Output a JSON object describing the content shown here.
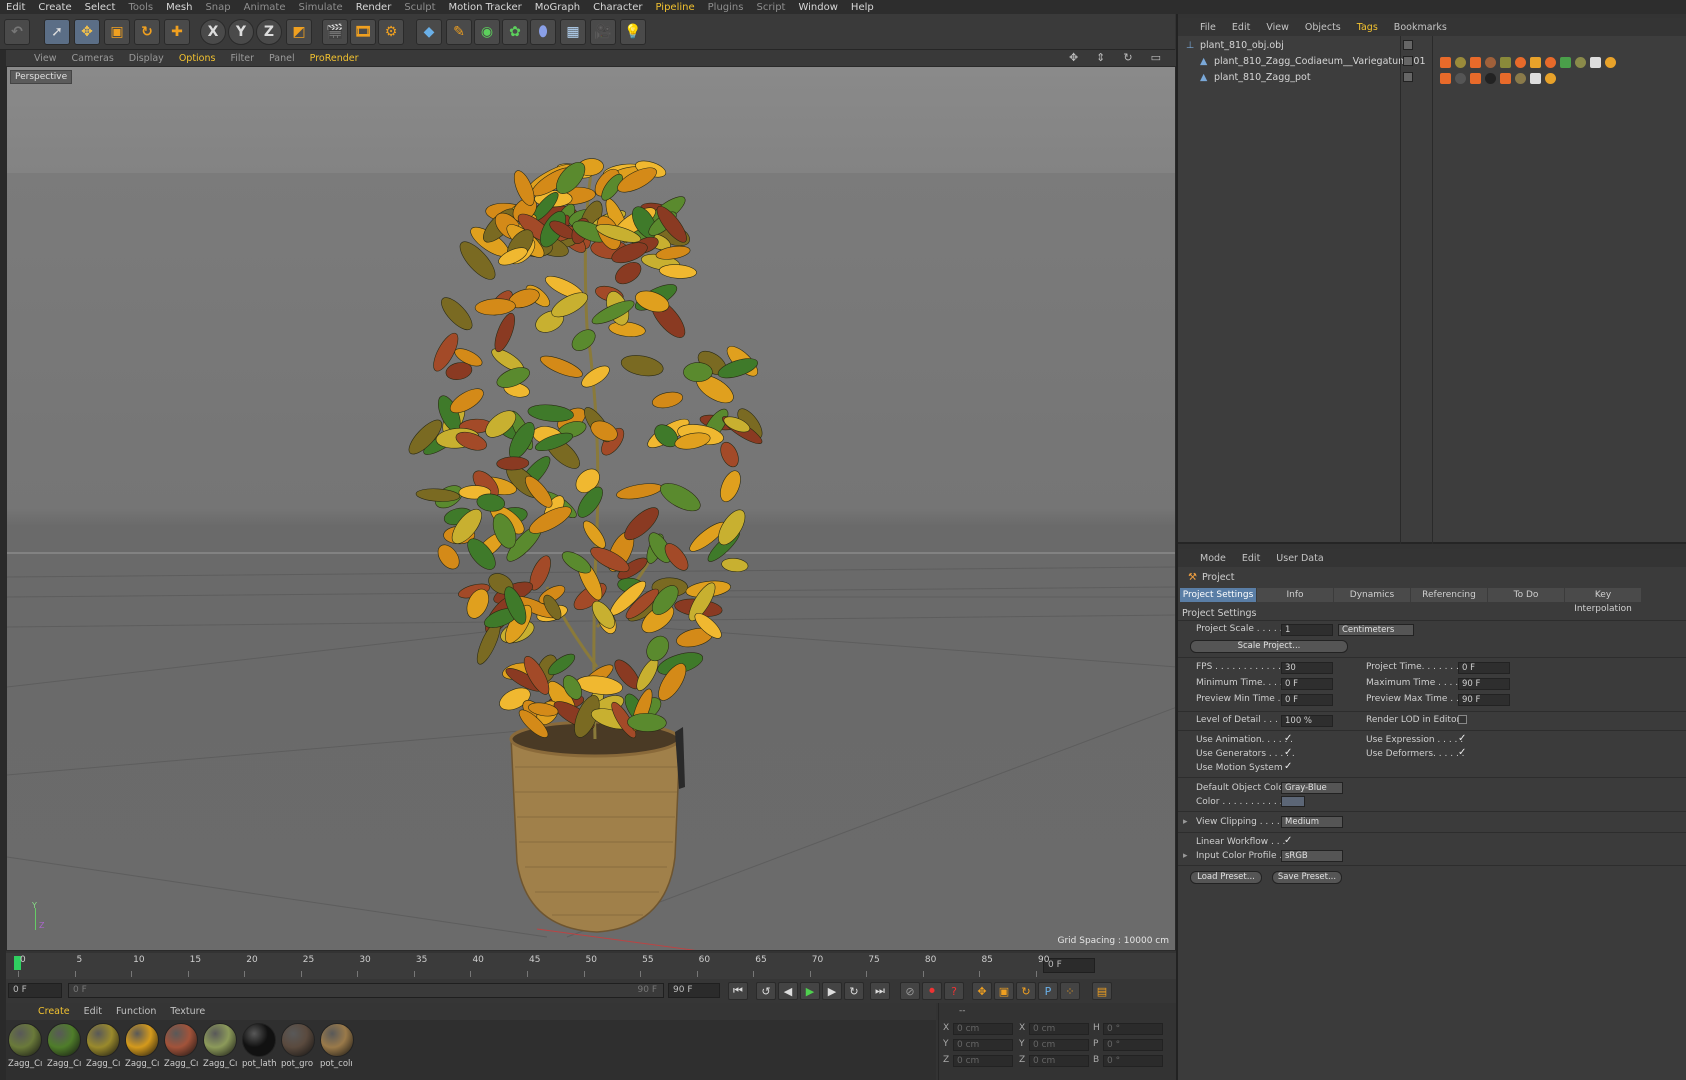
{
  "menubar": {
    "items": [
      {
        "label": "Edit",
        "style": "normal"
      },
      {
        "label": "Create",
        "style": "normal"
      },
      {
        "label": "Select",
        "style": "normal"
      },
      {
        "label": "Tools",
        "style": "dim"
      },
      {
        "label": "Mesh",
        "style": "normal"
      },
      {
        "label": "Snap",
        "style": "dim"
      },
      {
        "label": "Animate",
        "style": "dim"
      },
      {
        "label": "Simulate",
        "style": "dim"
      },
      {
        "label": "Render",
        "style": "normal"
      },
      {
        "label": "Sculpt",
        "style": "dim"
      },
      {
        "label": "Motion Tracker",
        "style": "normal"
      },
      {
        "label": "MoGraph",
        "style": "normal"
      },
      {
        "label": "Character",
        "style": "normal"
      },
      {
        "label": "Pipeline",
        "style": "hl"
      },
      {
        "label": "Plugins",
        "style": "dim"
      },
      {
        "label": "Script",
        "style": "dim"
      },
      {
        "label": "Window",
        "style": "normal"
      },
      {
        "label": "Help",
        "style": "normal"
      }
    ]
  },
  "toolbar": {
    "axis_x": "X",
    "axis_y": "Y",
    "axis_z": "Z"
  },
  "viewport": {
    "menu": [
      {
        "label": "View",
        "hl": false
      },
      {
        "label": "Cameras",
        "hl": false
      },
      {
        "label": "Display",
        "hl": false
      },
      {
        "label": "Options",
        "hl": true
      },
      {
        "label": "Filter",
        "hl": false
      },
      {
        "label": "Panel",
        "hl": false
      },
      {
        "label": "ProRender",
        "hl": true
      }
    ],
    "label": "Perspective",
    "grid_spacing": "Grid Spacing : 10000 cm",
    "axis_y": "Y",
    "axis_z": "Z"
  },
  "timeline": {
    "ticks": [
      "0",
      "5",
      "10",
      "15",
      "20",
      "25",
      "30",
      "35",
      "40",
      "45",
      "50",
      "55",
      "60",
      "65",
      "70",
      "75",
      "80",
      "85",
      "90"
    ],
    "end_field": "0 F",
    "current_frame": "0 F",
    "range_start": "0 F",
    "range_end": "90 F",
    "max_field": "90 F"
  },
  "material_manager": {
    "menu": [
      {
        "label": "Create",
        "hl": true
      },
      {
        "label": "Edit",
        "hl": false
      },
      {
        "label": "Function",
        "hl": false
      },
      {
        "label": "Texture",
        "hl": false
      }
    ],
    "materials": [
      {
        "label": "Zagg_Cı",
        "color": "#6a7a3a"
      },
      {
        "label": "Zagg_Cı",
        "color": "#4f7d2a"
      },
      {
        "label": "Zagg_Cı",
        "color": "#9a8a2c"
      },
      {
        "label": "Zagg_Cı",
        "color": "#d49a1c"
      },
      {
        "label": "Zagg_Cı",
        "color": "#a2533a"
      },
      {
        "label": "Zagg_Cı",
        "color": "#8c9a5a"
      },
      {
        "label": "pot_lath",
        "color": "#111111"
      },
      {
        "label": "pot_gro",
        "color": "#5a4a3e"
      },
      {
        "label": "pot_colı",
        "color": "#9a7a4a"
      }
    ]
  },
  "coordinates": {
    "rows": [
      {
        "a": "X",
        "v1": "0 cm",
        "b": "X",
        "v2": "0 cm",
        "c": "H",
        "v3": "0 °"
      },
      {
        "a": "Y",
        "v1": "0 cm",
        "b": "Y",
        "v2": "0 cm",
        "c": "P",
        "v3": "0 °"
      },
      {
        "a": "Z",
        "v1": "0 cm",
        "b": "Z",
        "v2": "0 cm",
        "c": "B",
        "v3": "0 °"
      }
    ],
    "header": "--"
  },
  "object_manager": {
    "menu": [
      {
        "label": "File",
        "hl": false
      },
      {
        "label": "Edit",
        "hl": false
      },
      {
        "label": "View",
        "hl": false
      },
      {
        "label": "Objects",
        "hl": false
      },
      {
        "label": "Tags",
        "hl": true
      },
      {
        "label": "Bookmarks",
        "hl": false
      }
    ],
    "objects": [
      {
        "name": "plant_810_obj.obj",
        "indent": 0
      },
      {
        "name": "plant_810_Zagg_Codiaeum__Variegatum001",
        "indent": 1
      },
      {
        "name": "plant_810_Zagg_pot",
        "indent": 1
      }
    ]
  },
  "attribute_manager": {
    "menu": [
      "Mode",
      "Edit",
      "User Data"
    ],
    "title": "Project",
    "tabs": [
      {
        "label": "Project Settings",
        "active": true
      },
      {
        "label": "Info",
        "active": false
      },
      {
        "label": "Dynamics",
        "active": false
      },
      {
        "label": "Referencing",
        "active": false
      },
      {
        "label": "To Do",
        "active": false
      },
      {
        "label": "Key Interpolation",
        "active": false
      }
    ],
    "section": "Project Settings",
    "project_scale_label": "Project Scale . . . . . .",
    "project_scale_value": "1",
    "project_scale_unit": "Centimeters",
    "scale_project_button": "Scale Project...",
    "fps_label": "FPS . . . . . . . . . . . . . .",
    "fps_value": "30",
    "project_time_label": "Project Time. . . . . . . .",
    "project_time_value": "0 F",
    "min_time_label": "Minimum Time. . . . . .",
    "min_time_value": "0 F",
    "max_time_label": "Maximum Time . . . . . .",
    "max_time_value": "90 F",
    "preview_min_label": "Preview Min Time . . .",
    "preview_min_value": "0 F",
    "preview_max_label": "Preview Max Time . . .",
    "preview_max_value": "90 F",
    "lod_label": "Level of Detail . . . . .",
    "lod_value": "100 %",
    "render_lod_label": "Render LOD in Editor",
    "use_animation_label": "Use Animation. . . . . .",
    "use_expression_label": "Use Expression . . . . .",
    "use_generators_label": "Use Generators . . . . .",
    "use_deformers_label": "Use Deformers. . . . . .",
    "use_motion_label": "Use Motion System",
    "default_color_label": "Default Object Color",
    "default_color_value": "Gray-Blue",
    "color_label": "Color . . . . . . . . . . .",
    "color_swatch": "#5c6676",
    "view_clipping_label": "View Clipping . . . . .",
    "view_clipping_value": "Medium",
    "linear_workflow_label": "Linear Workflow . . .",
    "input_color_label": "Input Color Profile . .",
    "input_color_value": "sRGB",
    "load_preset": "Load Preset...",
    "save_preset": "Save Preset...",
    "check": "✓"
  },
  "colors": {
    "accent": "#f2c230",
    "tab_active": "#5a7ea6"
  }
}
